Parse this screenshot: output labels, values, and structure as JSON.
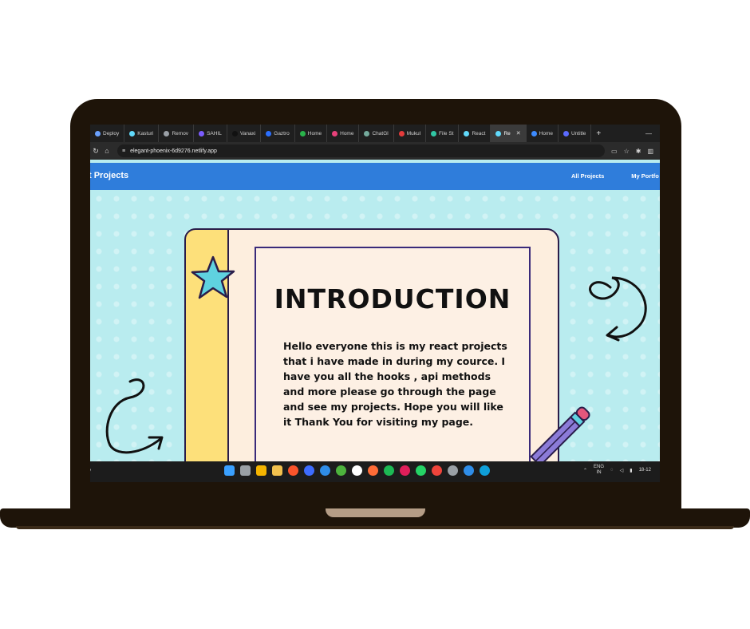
{
  "browser": {
    "tabs": [
      {
        "label": "Deploy",
        "color": "#6aa1ff"
      },
      {
        "label": "Kasturi",
        "color": "#61dafb"
      },
      {
        "label": "Remov",
        "color": "#9aa0a6"
      },
      {
        "label": "SAHIL",
        "color": "#7b5cff"
      },
      {
        "label": "Vanaxi",
        "color": "#111111"
      },
      {
        "label": "Gaztro",
        "color": "#2b6fff"
      },
      {
        "label": "Home",
        "color": "#29b34a"
      },
      {
        "label": "Home",
        "color": "#e8417a"
      },
      {
        "label": "ChatGl",
        "color": "#74aa9c"
      },
      {
        "label": "Mukul",
        "color": "#e43b3b"
      },
      {
        "label": "File St",
        "color": "#31c6a4"
      },
      {
        "label": "React",
        "color": "#61dafb"
      },
      {
        "label": "Re",
        "color": "#61dafb",
        "active": true
      },
      {
        "label": "Home",
        "color": "#3d8bff"
      },
      {
        "label": "Untitle",
        "color": "#5b6bff"
      }
    ],
    "new_tab": "+",
    "window_control": "—",
    "url": "elegant-phoenix-6d9276.netlify.app"
  },
  "site": {
    "brand": "t Projects",
    "nav": [
      "All Projects",
      "My Portfo"
    ]
  },
  "card": {
    "title": "INTRODUCTION",
    "body": "Hello everyone this is my react projects that i have made in during my cource. I have you all the hooks , api methods and more please go through the page and see my projects. Hope you will like it Thank You for visiting my page."
  },
  "taskbar": {
    "left_text": "y",
    "lang_top": "ENG",
    "lang_bottom": "IN",
    "clock": "18-12",
    "icons": [
      "windows-start-icon",
      "file-explorer-icon",
      "chrome-icon",
      "folder-icon",
      "brave-icon",
      "app-icon",
      "vscode-icon",
      "mongodb-icon",
      "app2-icon",
      "postman-icon",
      "spotify-icon",
      "slack-icon",
      "whatsapp-icon",
      "anydesk-icon",
      "settings-icon",
      "app3-icon",
      "edge-icon"
    ]
  },
  "colors": {
    "nav_blue": "#2f7ddb",
    "page_bg": "#b9ecef",
    "card_bg": "#fdeede",
    "binding_yellow": "#fde07a",
    "star": "#5fd2e0",
    "pencil": "#8b7bd8"
  }
}
